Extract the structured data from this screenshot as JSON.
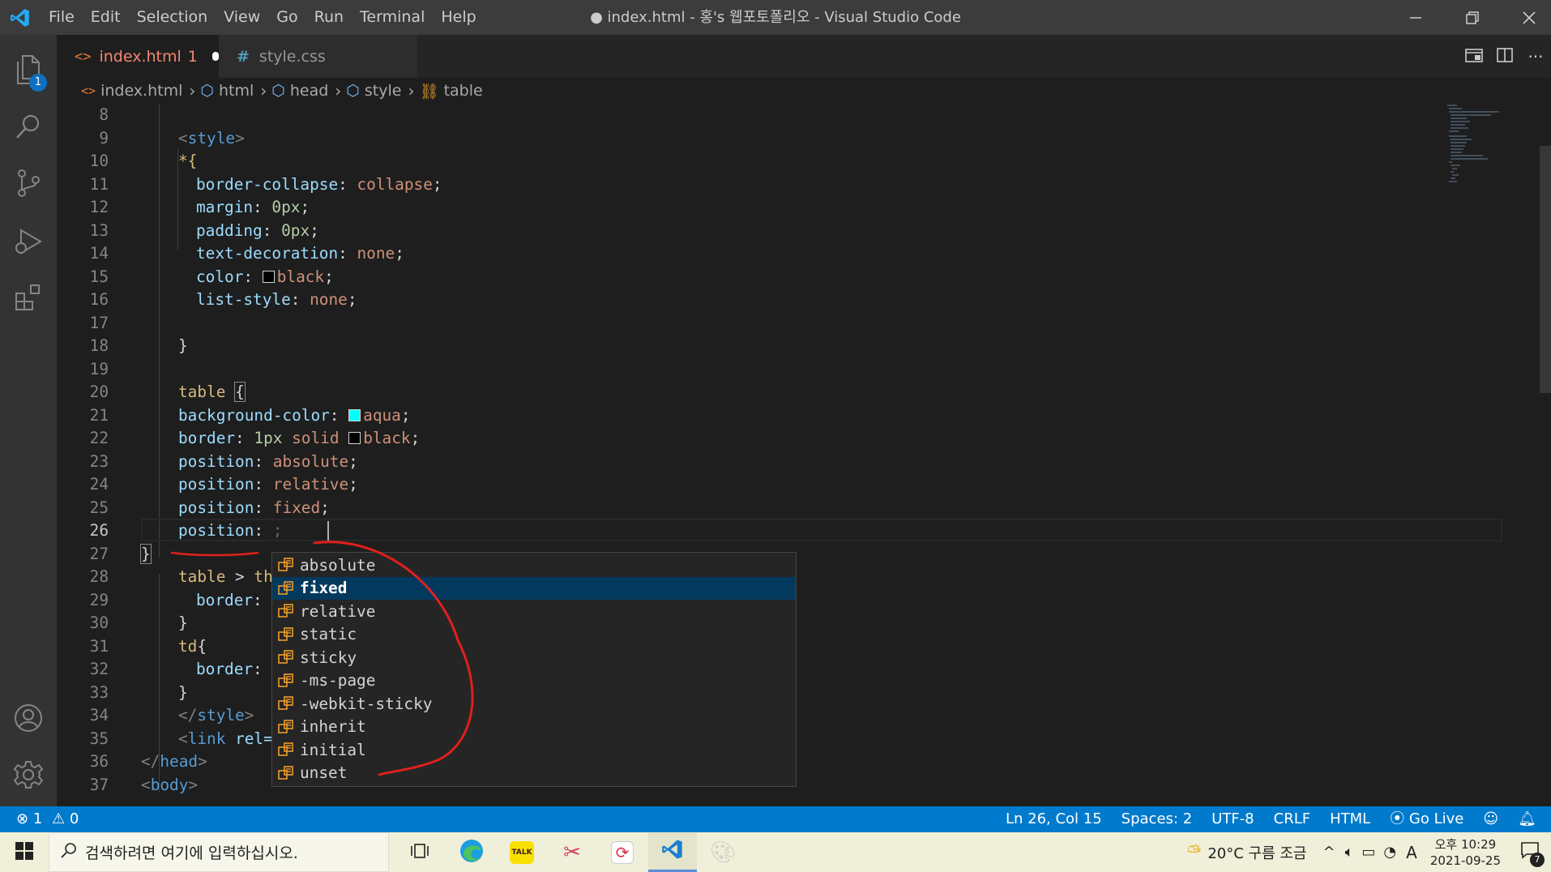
{
  "window": {
    "title": "● index.html - 홍's 웹포토폴리오 - Visual Studio Code",
    "menu": [
      "File",
      "Edit",
      "Selection",
      "View",
      "Go",
      "Run",
      "Terminal",
      "Help"
    ]
  },
  "activity_bar": {
    "explorer_badge": "1"
  },
  "tabs": [
    {
      "label": "index.html",
      "problems": "1",
      "icon": "html-icon",
      "modified": true
    },
    {
      "label": "style.css",
      "icon": "css-hash-icon"
    }
  ],
  "breadcrumb": [
    "index.html",
    "html",
    "head",
    "style",
    "table"
  ],
  "editor": {
    "lines": [
      {
        "n": "8"
      },
      {
        "n": "9"
      },
      {
        "n": "10"
      },
      {
        "n": "11"
      },
      {
        "n": "12"
      },
      {
        "n": "13"
      },
      {
        "n": "14"
      },
      {
        "n": "15"
      },
      {
        "n": "16"
      },
      {
        "n": "17"
      },
      {
        "n": "18"
      },
      {
        "n": "19"
      },
      {
        "n": "20"
      },
      {
        "n": "21"
      },
      {
        "n": "22"
      },
      {
        "n": "23"
      },
      {
        "n": "24"
      },
      {
        "n": "25"
      },
      {
        "n": "26"
      },
      {
        "n": "27"
      },
      {
        "n": "28"
      },
      {
        "n": "29"
      },
      {
        "n": "30"
      },
      {
        "n": "31"
      },
      {
        "n": "32"
      },
      {
        "n": "33"
      },
      {
        "n": "34"
      },
      {
        "n": "35"
      },
      {
        "n": "36"
      },
      {
        "n": "37"
      }
    ],
    "code": {
      "l9_tag": "style",
      "l10": "*{",
      "l11_prop": "border-collapse",
      "l11_val": "collapse",
      "l12_prop": "margin",
      "l12_val": "0px",
      "l13_prop": "padding",
      "l13_val": "0px",
      "l14_prop": "text-decoration",
      "l14_val": "none",
      "l15_prop": "color",
      "l15_val": "black",
      "l16_prop": "list-style",
      "l16_val": "none",
      "l18": "}",
      "l20_sel": "table",
      "l20_brace": "{",
      "l21_prop": "background-color",
      "l21_val": "aqua",
      "l22_prop": "border",
      "l22_num": "1px",
      "l22_v1": "solid",
      "l22_v2": "black",
      "l23_prop": "position",
      "l23_val": "absolute",
      "l24_prop": "position",
      "l24_val": "relative",
      "l25_prop": "position",
      "l25_val": "fixed",
      "l26_prop": "position",
      "l27": "}",
      "l28_sel": "table",
      "l28_rest": "th",
      "l29_prop": "border",
      "l30": "}",
      "l31_sel": "td",
      "l32_prop": "border",
      "l33": "}",
      "l34_tag": "style",
      "l35_tag": "link",
      "l35_attr": "rel=",
      "l36_tag": "head",
      "l37_tag": "body"
    },
    "swatches": {
      "black": "#000000",
      "aqua": "#00ffff"
    }
  },
  "suggestions": {
    "items": [
      "absolute",
      "fixed",
      "relative",
      "static",
      "sticky",
      "-ms-page",
      "-webkit-sticky",
      "inherit",
      "initial",
      "unset"
    ],
    "focused_index": 1
  },
  "statusbar": {
    "errors": "1",
    "warnings": "0",
    "position": "Ln 26, Col 15",
    "spaces": "Spaces: 2",
    "encoding": "UTF-8",
    "eol": "CRLF",
    "language": "HTML",
    "golive": "Go Live"
  },
  "taskbar": {
    "search_placeholder": "검색하려면 여기에 입력하십시오.",
    "weather": "20°C  구름 조금",
    "ime": "A",
    "time_ampm": "오후 10:29",
    "date": "2021-09-25",
    "notifications": "7"
  },
  "colors": {
    "accent": "#007acc",
    "titlebar": "#3c3c3c",
    "editor_bg": "#1e1e1e",
    "annotation_red": "#e0201b"
  }
}
